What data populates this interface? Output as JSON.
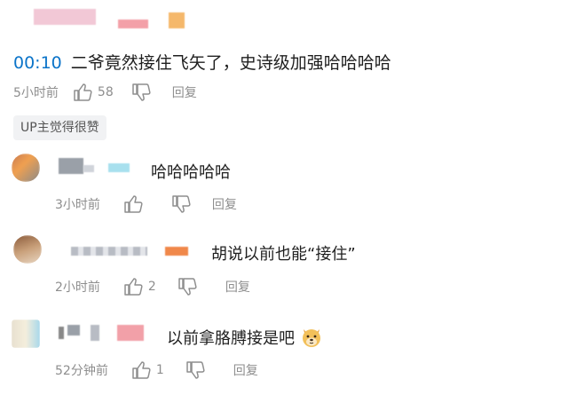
{
  "main_comment": {
    "timestamp": "00:10",
    "text": "二爷竟然接住飞矢了，史诗级加强哈哈哈哈",
    "time": "5小时前",
    "likes": "58",
    "reply_label": "回复",
    "badge": "UP主觉得很赞"
  },
  "replies": [
    {
      "text": "哈哈哈哈哈",
      "time": "3小时前",
      "likes": "",
      "reply_label": "回复"
    },
    {
      "text": "胡说以前也能“接住”",
      "time": "2小时前",
      "likes": "2",
      "reply_label": "回复"
    },
    {
      "text": "以前拿胳膊接是吧",
      "emoji": "dog-face-emoji",
      "time": "52分钟前",
      "likes": "1",
      "reply_label": "回复"
    }
  ],
  "colors": {
    "timestamp_blue": "#0b74c9",
    "meta_gray": "#8e8e8e",
    "badge_bg": "#f1f2f4"
  }
}
